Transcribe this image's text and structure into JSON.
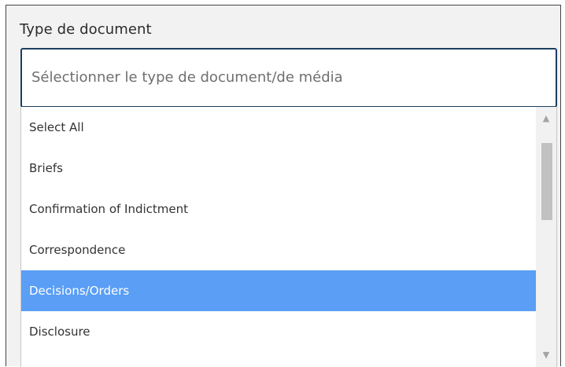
{
  "field": {
    "label": "Type de document",
    "placeholder": "Sélectionner le type de document/de média"
  },
  "dropdown": {
    "options": [
      {
        "label": "Select All"
      },
      {
        "label": "Briefs"
      },
      {
        "label": "Confirmation of Indictment"
      },
      {
        "label": "Correspondence"
      },
      {
        "label": "Decisions/Orders",
        "selected": true
      },
      {
        "label": "Disclosure"
      }
    ],
    "highlight_color": "#5a9ef5"
  },
  "scrollbar": {
    "up_icon": "chevron-up-icon",
    "down_icon": "chevron-down-icon"
  }
}
